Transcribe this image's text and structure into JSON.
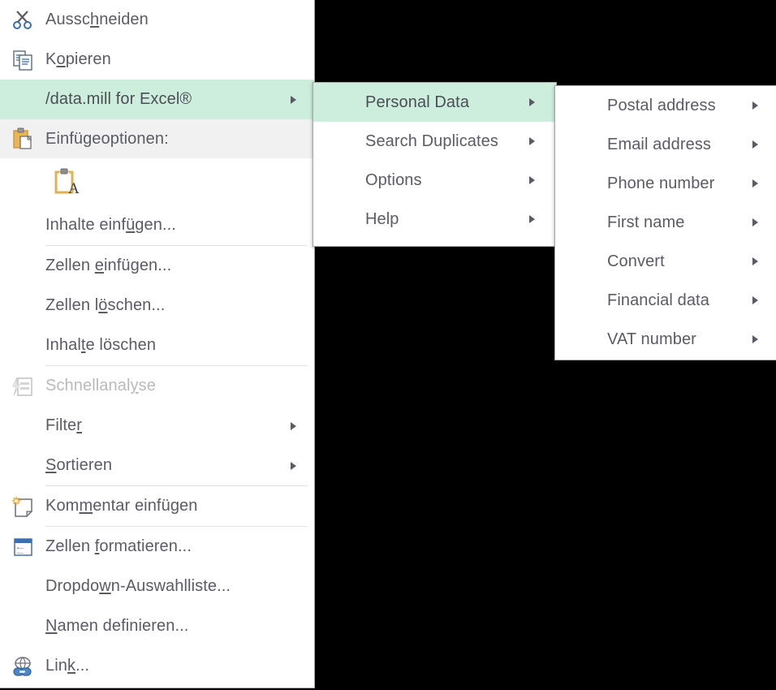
{
  "colors": {
    "highlight": "#cdeedd",
    "header_bg": "#f1f1f1",
    "text": "#5b5b66",
    "disabled_text": "#b9b9bf",
    "menu_bg": "#ffffff",
    "border": "#a7a7a7",
    "separator": "#e2e2e2",
    "backdrop": "#000000"
  },
  "context_menu": {
    "name": "excel-cell-context-menu",
    "items": [
      {
        "id": "cut",
        "label": "Ausschneiden",
        "accel": "c",
        "icon": "scissors-icon",
        "type": "item",
        "state": "normal",
        "submenu": false
      },
      {
        "id": "copy",
        "label": "Kopieren",
        "accel": "o",
        "icon": "copy-icon",
        "type": "item",
        "state": "normal",
        "submenu": false
      },
      {
        "id": "datamill",
        "label": "/data.mill for Excel®",
        "accel": "",
        "icon": "",
        "type": "item",
        "state": "highlighted",
        "submenu": true
      },
      {
        "id": "paste-options",
        "label": "Einfügeoptionen:",
        "accel": "",
        "icon": "clipboard-icon",
        "type": "header",
        "state": "normal",
        "submenu": false
      },
      {
        "id": "paste-values",
        "label": "",
        "accel": "",
        "icon": "clipboard-text-icon",
        "type": "gallery",
        "state": "normal",
        "submenu": false
      },
      {
        "id": "paste-special",
        "label": "Inhalte einfügen...",
        "accel": "ü",
        "icon": "",
        "type": "item",
        "state": "normal",
        "submenu": false
      },
      {
        "id": "sep-1",
        "label": "",
        "accel": "",
        "icon": "",
        "type": "separator",
        "state": "normal",
        "submenu": false
      },
      {
        "id": "insert-cells",
        "label": "Zellen einfügen...",
        "accel": "e",
        "icon": "",
        "type": "item",
        "state": "normal",
        "submenu": false
      },
      {
        "id": "delete-cells",
        "label": "Zellen löschen...",
        "accel": "ö",
        "icon": "",
        "type": "item",
        "state": "normal",
        "submenu": false
      },
      {
        "id": "clear-contents",
        "label": "Inhalte löschen",
        "accel": "t",
        "icon": "",
        "type": "item",
        "state": "normal",
        "submenu": false
      },
      {
        "id": "sep-2",
        "label": "",
        "accel": "",
        "icon": "",
        "type": "separator",
        "state": "normal",
        "submenu": false
      },
      {
        "id": "quick-analysis",
        "label": "Schnellanalyse",
        "accel": "y",
        "icon": "quick-analysis-icon",
        "type": "item",
        "state": "disabled",
        "submenu": false
      },
      {
        "id": "filter",
        "label": "Filter",
        "accel": "r",
        "icon": "",
        "type": "item",
        "state": "normal",
        "submenu": true
      },
      {
        "id": "sort",
        "label": "Sortieren",
        "accel": "S",
        "icon": "",
        "type": "item",
        "state": "normal",
        "submenu": true
      },
      {
        "id": "sep-3",
        "label": "",
        "accel": "",
        "icon": "",
        "type": "separator",
        "state": "normal",
        "submenu": false
      },
      {
        "id": "insert-comment",
        "label": "Kommentar einfügen",
        "accel": "m",
        "icon": "comment-icon",
        "type": "item",
        "state": "normal",
        "submenu": false
      },
      {
        "id": "sep-4",
        "label": "",
        "accel": "",
        "icon": "",
        "type": "separator",
        "state": "normal",
        "submenu": false
      },
      {
        "id": "format-cells",
        "label": "Zellen formatieren...",
        "accel": "f",
        "icon": "format-cells-icon",
        "type": "item",
        "state": "normal",
        "submenu": false
      },
      {
        "id": "pick-dropdown",
        "label": "Dropdown-Auswahlliste...",
        "accel": "w",
        "icon": "",
        "type": "item",
        "state": "normal",
        "submenu": false
      },
      {
        "id": "define-name",
        "label": "Namen definieren...",
        "accel": "N",
        "icon": "",
        "type": "item",
        "state": "normal",
        "submenu": false
      },
      {
        "id": "hyperlink",
        "label": "Link...",
        "accel": "k",
        "icon": "hyperlink-icon",
        "type": "item",
        "state": "normal",
        "submenu": false
      }
    ]
  },
  "submenu_datamill": {
    "name": "datamill-submenu",
    "items": [
      {
        "id": "personal-data",
        "label": "Personal Data",
        "state": "highlighted",
        "submenu": true
      },
      {
        "id": "search-duplicates",
        "label": "Search Duplicates",
        "state": "normal",
        "submenu": true
      },
      {
        "id": "options",
        "label": "Options",
        "state": "normal",
        "submenu": true
      },
      {
        "id": "help",
        "label": "Help",
        "state": "normal",
        "submenu": true
      }
    ]
  },
  "submenu_personal_data": {
    "name": "personal-data-submenu",
    "items": [
      {
        "id": "postal-address",
        "label": "Postal address",
        "state": "normal",
        "submenu": true
      },
      {
        "id": "email-address",
        "label": "Email address",
        "state": "normal",
        "submenu": true
      },
      {
        "id": "phone-number",
        "label": "Phone number",
        "state": "normal",
        "submenu": true
      },
      {
        "id": "first-name",
        "label": "First name",
        "state": "normal",
        "submenu": true
      },
      {
        "id": "convert",
        "label": "Convert",
        "state": "normal",
        "submenu": true
      },
      {
        "id": "financial-data",
        "label": "Financial data",
        "state": "normal",
        "submenu": true
      },
      {
        "id": "vat-number",
        "label": "VAT number",
        "state": "normal",
        "submenu": true
      }
    ]
  }
}
